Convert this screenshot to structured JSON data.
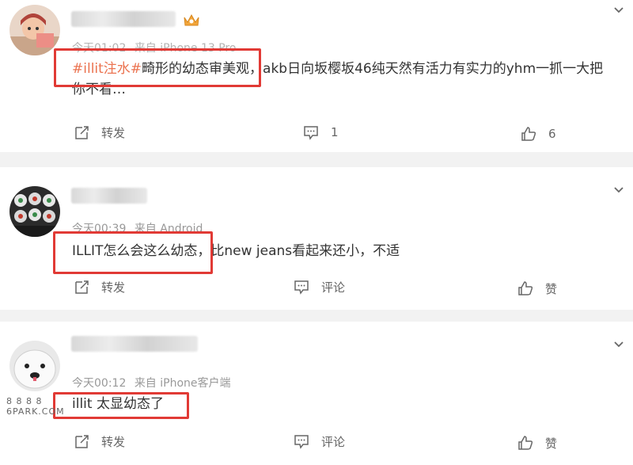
{
  "posts": [
    {
      "time": "今天01:02",
      "source": "来自 iPhone 13 Pro",
      "hashtag": "#illit注水#",
      "text_line1": "畸形的幼态审美观，akb日向坂樱坂46纯天然有活力有实力的yhm一抓一大把",
      "text_line2": "你不看…",
      "repost_label": "转发",
      "comment_count": "1",
      "like_count": "6"
    },
    {
      "time": "今天00:39",
      "source": "来自 Android",
      "text": "ILLIT怎么会这么幼态，比new jeans看起来还小，不适",
      "repost_label": "转发",
      "comment_label": "评论",
      "like_label": "赞"
    },
    {
      "time": "今天00:12",
      "source": "来自 iPhone客户端",
      "text": "illit 太显幼态了",
      "repost_label": "转发",
      "comment_label": "评论",
      "like_label": "赞"
    }
  ],
  "watermark": {
    "line1": "8 8 8 8",
    "line2": "6PARK.COM"
  },
  "colors": {
    "hashtag": "#eb7350",
    "highlight_box": "#e13a35",
    "meta_text": "#999999"
  },
  "icons": [
    "chevron-down-icon",
    "crown-icon",
    "repost-icon",
    "comment-icon",
    "like-icon"
  ]
}
